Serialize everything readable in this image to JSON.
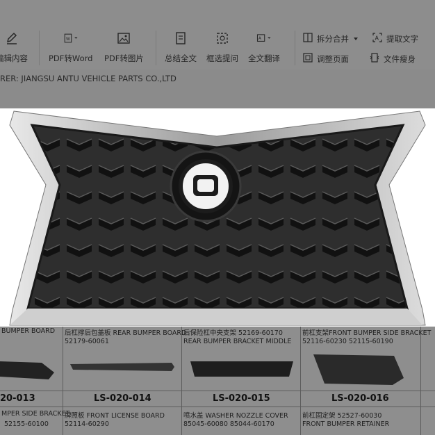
{
  "toolbar": {
    "edit_label": "编辑内容",
    "pdf_word": "PDF转Word",
    "pdf_image": "PDF转图片",
    "summary": "总结全文",
    "box_question": "框选提问",
    "full_translate": "全文翻译",
    "split_merge": "拆分合并",
    "extract_text": "提取文字",
    "adjust_page": "调整页面",
    "file_slim": "文件瘦身"
  },
  "header": {
    "manufacturer": "RER: JIANGSU ANTU VEHICLE PARTS CO.,LTD"
  },
  "catalog": {
    "cells": [
      {
        "top": "BUMPER BOARD",
        "code": "20-013",
        "b1": "MPER SIDE BRACKET",
        "b2": "52155-60100"
      },
      {
        "top": "后杠撑后包盖板 REAR BUMPER BOARD",
        "top2": "52179-60061",
        "code": "LS-020-014",
        "b1": "牌照板 FRONT LICENSE BOARD",
        "b2": "52114-60290"
      },
      {
        "top": "后保险杠中央支架 52169-60170",
        "top2": "REAR BUMPER BRACKET MIDDLE",
        "code": "LS-020-015",
        "b1": "喷水盖 WASHER NOZZLE COVER",
        "b2": "85045-60080     85044-60170"
      },
      {
        "top": "前杠支架FRONT BUMPER SIDE BRACKET",
        "top2": "52116-60230     52115-60190",
        "code": "LS-020-016",
        "b1": "前杠固定架 52527-60030",
        "b2": "FRONT BUMPER  RETAINER"
      }
    ]
  },
  "colors": {
    "dim_background": "#8b8b8b",
    "photo_background": "#ffffff",
    "grille_black": "#1c1c1c",
    "chrome": "#c9c9c9"
  }
}
